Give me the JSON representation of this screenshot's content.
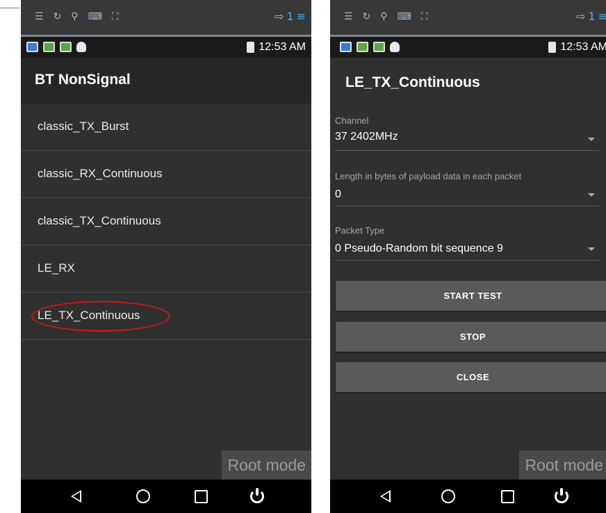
{
  "left": {
    "time": "12:53 AM",
    "notif_count": "1",
    "title": "BT NonSignal",
    "items": [
      {
        "label": "classic_TX_Burst"
      },
      {
        "label": "classic_RX_Continuous"
      },
      {
        "label": "classic_TX_Continuous"
      },
      {
        "label": "LE_RX"
      },
      {
        "label": "LE_TX_Continuous"
      }
    ],
    "root_mode": "Root mode"
  },
  "right": {
    "time": "12:53 AM",
    "notif_count": "1",
    "title": "LE_TX_Continuous",
    "channel": {
      "label": "Channel",
      "value": "37  2402MHz"
    },
    "length": {
      "label": "Length in bytes of payload data in each packet",
      "value": "0"
    },
    "packet_type": {
      "label": "Packet Type",
      "value": "0  Pseudo-Random bit sequence 9"
    },
    "buttons": {
      "start": "START TEST",
      "stop": "STOP",
      "close": "CLOSE"
    },
    "root_mode": "Root mode"
  },
  "colors": {
    "highlight": "#d01818",
    "accent": "#3bb8f5"
  },
  "icons": [
    "menu-icon",
    "sync-icon",
    "search-icon",
    "keyboard-icon",
    "fullscreen-icon",
    "export-icon",
    "back-icon",
    "home-icon",
    "recents-icon",
    "power-icon"
  ]
}
